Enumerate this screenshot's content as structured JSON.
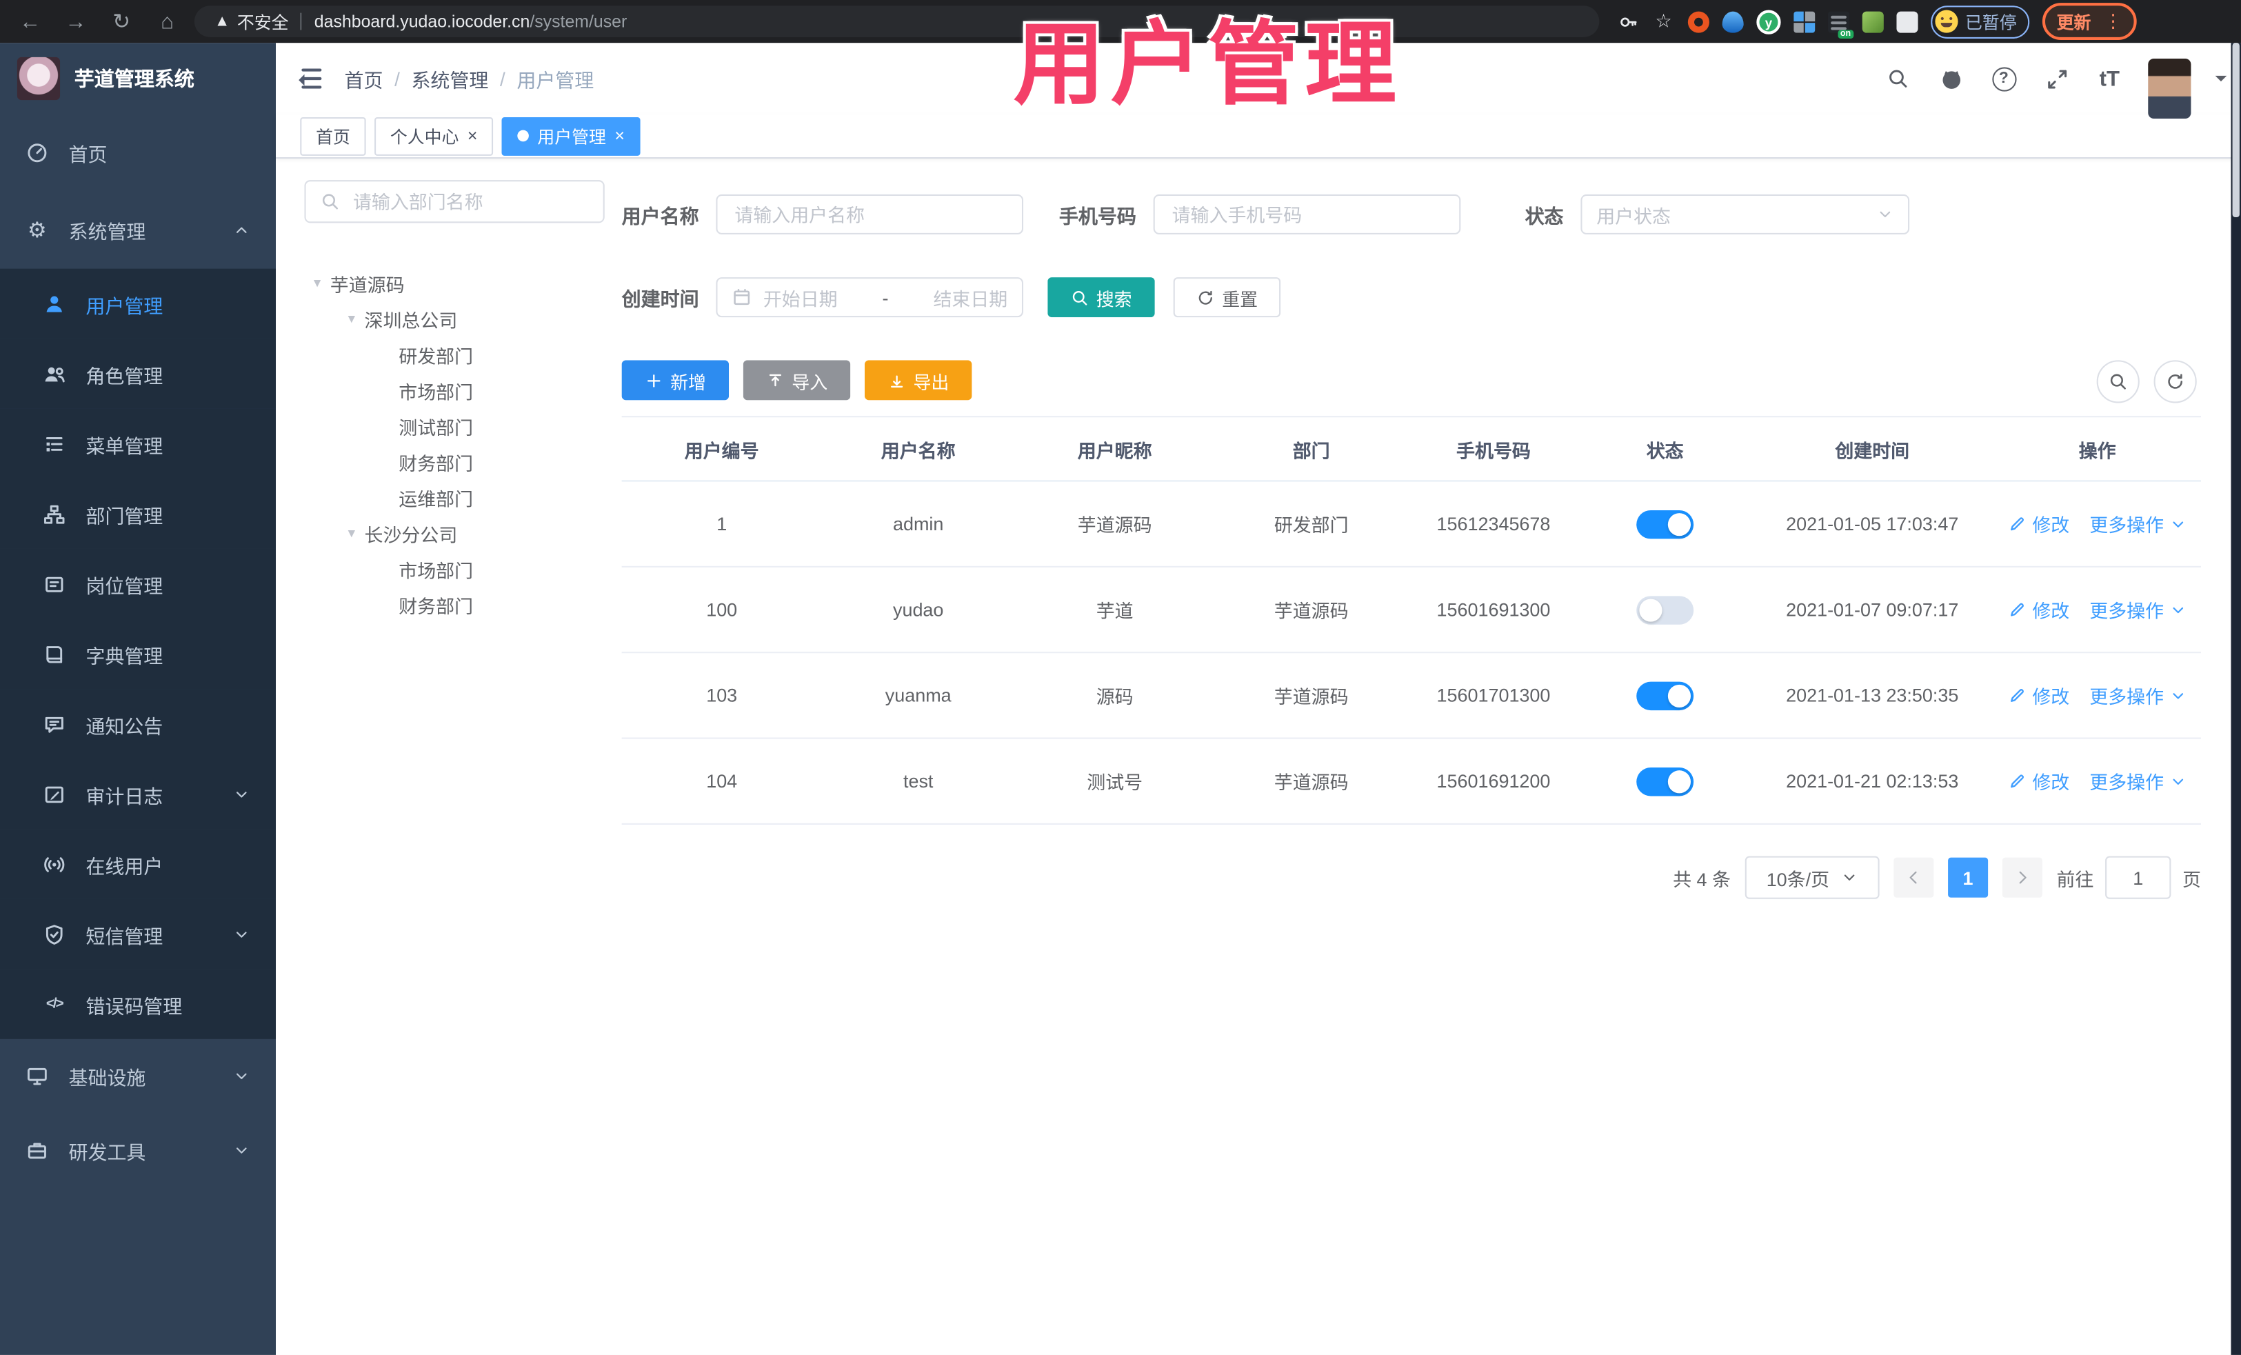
{
  "watermark": "用户管理",
  "colors": {
    "primary": "#409EFF",
    "search_button": "#18a7a0",
    "add_button": "#2d8cf0",
    "import_button": "#909399",
    "export_button": "#f7a114",
    "toggle_on": "#1890ff",
    "tab_active_bg": "#409EFF",
    "sidebar_bg": "#304156",
    "submenu_bg": "#1f2d3d",
    "watermark": "#f43f68"
  },
  "browser": {
    "nav_icons": [
      "back-icon",
      "forward-icon",
      "reload-icon",
      "home-icon"
    ],
    "security_label": "不安全",
    "url_host": "dashboard.yudao.iocoder.cn",
    "url_path": "/system/user",
    "toolbar_icons": [
      "key-icon",
      "star-icon"
    ],
    "extension_icons": [
      "ubuntu-icon",
      "drop-icon",
      "yudao-icon",
      "blocks-icon",
      "proxy-icon",
      "green-key-icon",
      "puzzle-icon"
    ],
    "proxy_badge": "on",
    "profile_badge": "已暂停",
    "update_label": "更新",
    "menu_icon": "kebab-menu-icon"
  },
  "sidebar": {
    "app_title": "芋道管理系统",
    "menu": [
      {
        "label": "首页",
        "icon": "dashboard-icon",
        "type": "top",
        "pos": "first"
      },
      {
        "label": "系统管理",
        "icon": "gear-icon",
        "type": "top",
        "pos": "second",
        "arrow": "up"
      },
      {
        "label": "用户管理",
        "icon": "user-icon",
        "type": "sub",
        "active": true
      },
      {
        "label": "角色管理",
        "icon": "users-icon",
        "type": "sub"
      },
      {
        "label": "菜单管理",
        "icon": "menu-tree-icon",
        "type": "sub"
      },
      {
        "label": "部门管理",
        "icon": "org-tree-icon",
        "type": "sub"
      },
      {
        "label": "岗位管理",
        "icon": "post-icon",
        "type": "sub"
      },
      {
        "label": "字典管理",
        "icon": "dict-icon",
        "type": "sub"
      },
      {
        "label": "通知公告",
        "icon": "announcement-icon",
        "type": "sub"
      },
      {
        "label": "审计日志",
        "icon": "log-icon",
        "type": "sub",
        "arrow": "down"
      },
      {
        "label": "在线用户",
        "icon": "online-icon",
        "type": "sub"
      },
      {
        "label": "短信管理",
        "icon": "sms-icon",
        "type": "sub",
        "arrow": "down"
      },
      {
        "label": "错误码管理",
        "icon": "code-icon",
        "type": "sub"
      },
      {
        "label": "基础设施",
        "icon": "infra-icon",
        "type": "top",
        "arrow": "down"
      },
      {
        "label": "研发工具",
        "icon": "tools-icon",
        "type": "top",
        "arrow": "down"
      }
    ]
  },
  "header": {
    "breadcrumb": [
      "首页",
      "系统管理",
      "用户管理"
    ],
    "right_icons": [
      "search-icon",
      "github-icon",
      "help-icon",
      "fullscreen-icon",
      "font-size-icon",
      "user-avatar",
      "chevron-down-icon"
    ]
  },
  "tabs": [
    {
      "label": "首页",
      "closable": false,
      "active": false
    },
    {
      "label": "个人中心",
      "closable": true,
      "active": false
    },
    {
      "label": "用户管理",
      "closable": true,
      "active": true
    }
  ],
  "dept_panel": {
    "search_placeholder": "请输入部门名称",
    "tree": [
      {
        "label": "芋道源码",
        "depth": 0,
        "expandable": true
      },
      {
        "label": "深圳总公司",
        "depth": 1,
        "expandable": true
      },
      {
        "label": "研发部门",
        "depth": 2,
        "expandable": false
      },
      {
        "label": "市场部门",
        "depth": 2,
        "expandable": false
      },
      {
        "label": "测试部门",
        "depth": 2,
        "expandable": false
      },
      {
        "label": "财务部门",
        "depth": 2,
        "expandable": false
      },
      {
        "label": "运维部门",
        "depth": 2,
        "expandable": false
      },
      {
        "label": "长沙分公司",
        "depth": 1,
        "expandable": true
      },
      {
        "label": "市场部门",
        "depth": 2,
        "expandable": false
      },
      {
        "label": "财务部门",
        "depth": 2,
        "expandable": false
      }
    ]
  },
  "filter": {
    "username_label": "用户名称",
    "username_placeholder": "请输入用户名称",
    "mobile_label": "手机号码",
    "mobile_placeholder": "请输入手机号码",
    "status_label": "状态",
    "status_placeholder": "用户状态",
    "time_label": "创建时间",
    "start_placeholder": "开始日期",
    "range_separator": "-",
    "end_placeholder": "结束日期",
    "search_label": "搜索",
    "reset_label": "重置"
  },
  "toolbar": {
    "add_label": "新增",
    "import_label": "导入",
    "export_label": "导出"
  },
  "table": {
    "columns": [
      "用户编号",
      "用户名称",
      "用户昵称",
      "部门",
      "手机号码",
      "状态",
      "创建时间",
      "操作"
    ],
    "edit_label": "修改",
    "more_label": "更多操作",
    "rows": [
      {
        "id": "1",
        "username": "admin",
        "nickname": "芋道源码",
        "dept": "研发部门",
        "mobile": "15612345678",
        "status": true,
        "created": "2021-01-05 17:03:47"
      },
      {
        "id": "100",
        "username": "yudao",
        "nickname": "芋道",
        "dept": "芋道源码",
        "mobile": "15601691300",
        "status": false,
        "created": "2021-01-07 09:07:17"
      },
      {
        "id": "103",
        "username": "yuanma",
        "nickname": "源码",
        "dept": "芋道源码",
        "mobile": "15601701300",
        "status": true,
        "created": "2021-01-13 23:50:35"
      },
      {
        "id": "104",
        "username": "test",
        "nickname": "测试号",
        "dept": "芋道源码",
        "mobile": "15601691200",
        "status": true,
        "created": "2021-01-21 02:13:53"
      }
    ]
  },
  "pagination": {
    "total_label": "共 4 条",
    "page_size_label": "10条/页",
    "pages": [
      "1"
    ],
    "current_page": "1",
    "goto_label": "前往",
    "goto_value": "1",
    "page_unit_label": "页"
  }
}
